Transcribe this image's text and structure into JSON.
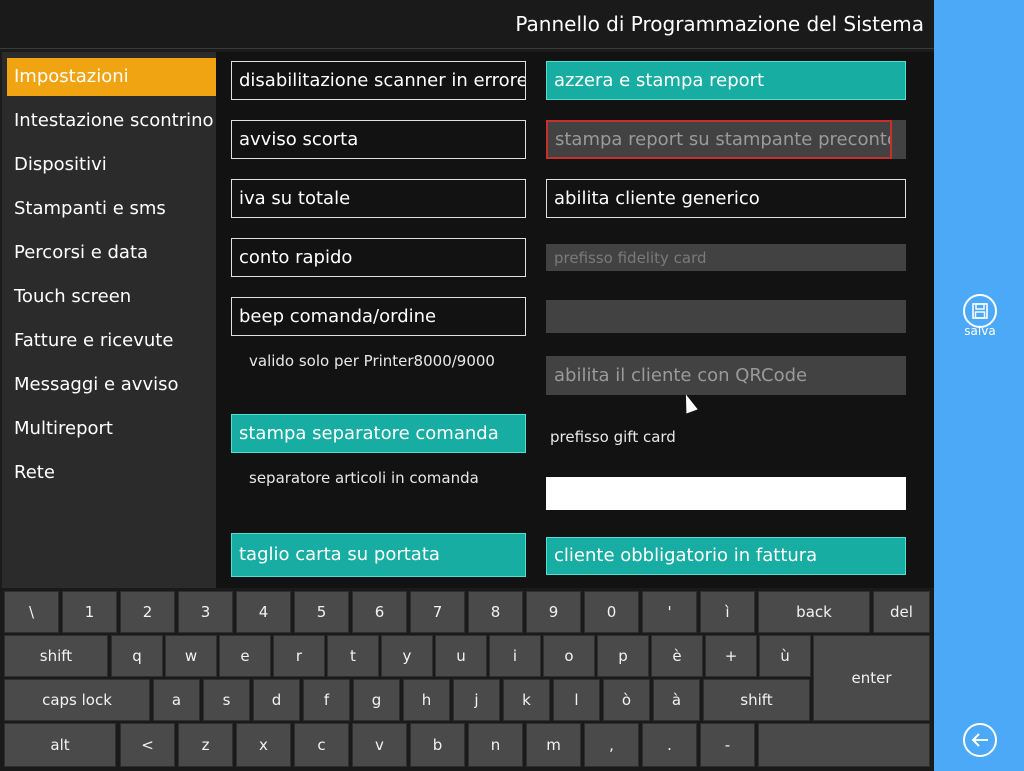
{
  "header": {
    "title": "Pannello di Programmazione del Sistema"
  },
  "sidebar": {
    "items": [
      {
        "label": "Impostazioni",
        "active": true
      },
      {
        "label": "Intestazione scontrino"
      },
      {
        "label": "Dispositivi"
      },
      {
        "label": "Stampanti e sms"
      },
      {
        "label": "Percorsi e data"
      },
      {
        "label": "Touch screen"
      },
      {
        "label": "Fatture e ricevute"
      },
      {
        "label": "Messaggi e avviso"
      },
      {
        "label": "Multireport"
      },
      {
        "label": "Rete"
      }
    ]
  },
  "options": {
    "scanner_error": "disabilitazione scanner in errore",
    "stock_warning": "avviso scorta",
    "vat_total": "iva su totale",
    "quick_account": "conto rapido",
    "beep_order": "beep comanda/ordine",
    "beep_note": "valido solo per Printer8000/9000",
    "print_separator": "stampa separatore comanda",
    "separator_note": "separatore articoli in comanda",
    "cut_paper": "taglio carta su portata",
    "reset_print_report": "azzera e stampa report",
    "print_report_preconto": "stampa report su stampante preconto",
    "generic_customer": "abilita cliente generico",
    "fidelity_prefix": "prefisso fidelity card",
    "qr_customer": "abilita il cliente con QRCode",
    "gift_card_prefix": "prefisso gift card",
    "gift_card_value": "",
    "customer_required": "cliente obbligatorio in fattura"
  },
  "actions": {
    "save_label": "salva"
  },
  "colors": {
    "accent": "#f0a412",
    "toggle_on": "#17ada3",
    "panel": "#4ba9f7"
  },
  "keyboard": {
    "row1": [
      "\\",
      "1",
      "2",
      "3",
      "4",
      "5",
      "6",
      "7",
      "8",
      "9",
      "0",
      "'",
      "ì",
      "back",
      "del"
    ],
    "row2": [
      "shift",
      "q",
      "w",
      "e",
      "r",
      "t",
      "y",
      "u",
      "i",
      "o",
      "p",
      "è",
      "+",
      "ù",
      "enter"
    ],
    "row3": [
      "caps lock",
      "a",
      "s",
      "d",
      "f",
      "g",
      "h",
      "j",
      "k",
      "l",
      "ò",
      "à",
      "shift"
    ],
    "row4": [
      "alt",
      "<",
      "z",
      "x",
      "c",
      "v",
      "b",
      "n",
      "m",
      ",",
      ".",
      "-"
    ]
  }
}
